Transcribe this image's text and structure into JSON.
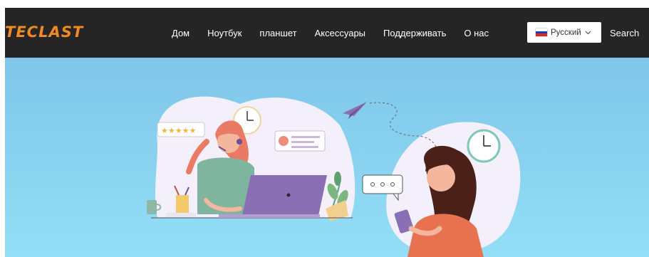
{
  "header": {
    "logo_text": "TECLAST",
    "nav": [
      {
        "label": "Дом"
      },
      {
        "label": "Ноутбук"
      },
      {
        "label": "планшет"
      },
      {
        "label": "Аксессуары"
      },
      {
        "label": "Поддерживать"
      },
      {
        "label": "О нас"
      }
    ],
    "language": {
      "selected": "Русский",
      "flag_icon": "russia-flag-icon"
    },
    "search_label": "Search"
  },
  "colors": {
    "navbar_bg": "#252525",
    "brand_orange": "#f08a24",
    "hero_top": "#7fc6ea",
    "hero_bottom": "#93dff7"
  },
  "hero": {
    "illustration": "customer-support-agent-and-user-chatting",
    "rating_stars": 5
  }
}
